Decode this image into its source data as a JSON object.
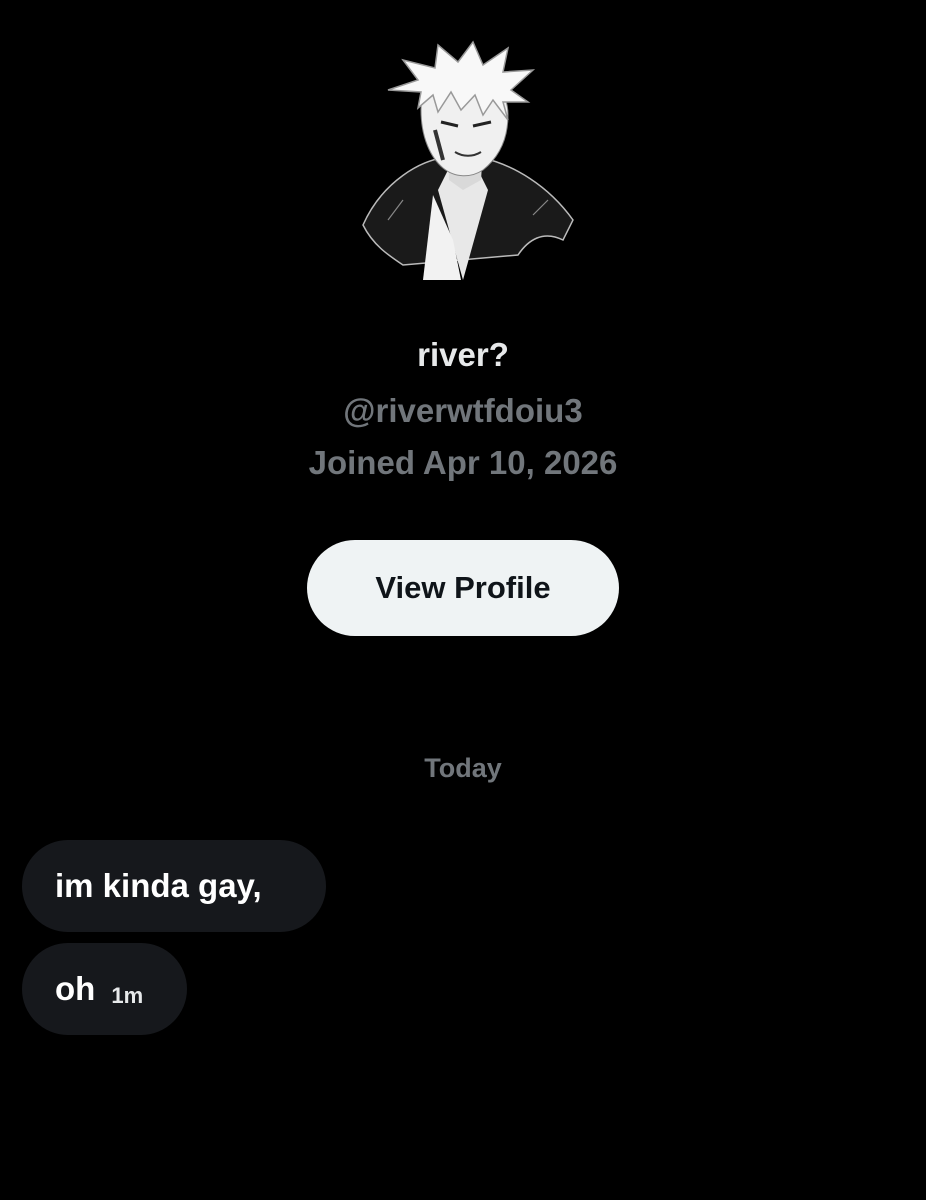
{
  "profile": {
    "display_name": "river?",
    "handle": "@riverwtfdoiu3",
    "joined": "Joined Apr 10, 2026",
    "view_profile_label": "View Profile"
  },
  "conversation": {
    "date_divider": "Today",
    "messages": [
      {
        "text": "im kinda gay,",
        "time": ""
      },
      {
        "text": "oh",
        "time": "1m"
      }
    ]
  },
  "theme": {
    "background": "#000000",
    "primary_text": "#e7e9ea",
    "secondary_text": "#71767b",
    "button_bg": "#eff3f4",
    "bubble_bg": "#16181c"
  }
}
